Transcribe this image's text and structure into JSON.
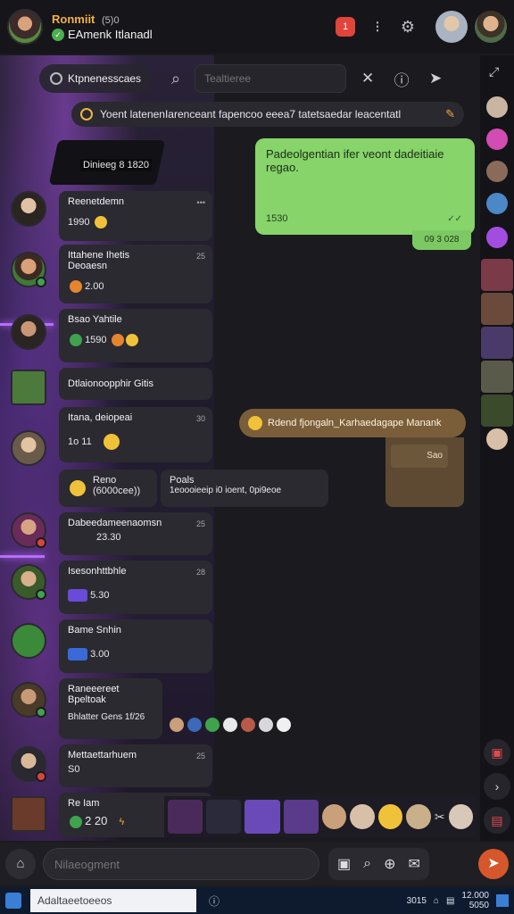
{
  "header": {
    "title": "Ronmiit",
    "title_suffix": "(5)0",
    "subtitle": "EAmenk Itlanadl",
    "notify_badge": "1"
  },
  "search": {
    "room_label": "Ktpnenesscaes",
    "placeholder": "Tealtieree"
  },
  "pinned": {
    "text": "Yoent latenenIarenceant fapencoo eeea7 tatetsaedar leacentatl"
  },
  "screen_label": "Dinieeg 8 1820",
  "messages_left": [
    {
      "name": "Reenetdemn",
      "meta": "•••",
      "time": "1990"
    },
    {
      "name": "Ittahene Ihetis",
      "line2": "Deoaesn",
      "meta": "25",
      "time": "2.00"
    },
    {
      "name": "Bsao Yahtile",
      "meta": "",
      "time": "1590"
    },
    {
      "name": "Dtlaionoopphir Gitis"
    },
    {
      "name": "Itana, deiopeai",
      "meta": "30",
      "time": "1o 11"
    },
    {
      "name": "Reno",
      "time": "(6000cee))"
    },
    {
      "name": "Poals",
      "body": "1eoooieeip i0 ioent, 0pi9eoe"
    },
    {
      "name": "Dabeedameenaomsn",
      "meta": "25",
      "time": "23.30"
    },
    {
      "name": "Isesonhttbhle",
      "meta": "28",
      "time": "5.30"
    },
    {
      "name": "Bame Snhin",
      "meta": "",
      "time": "3.00"
    },
    {
      "name": "Raneeereet",
      "line2": "Bpeltoak",
      "line3": "Bhlatter Gens 1f/26"
    },
    {
      "name": "Mettaettarhuem",
      "meta": "25",
      "time": "S0"
    },
    {
      "name": "Re Iam",
      "time": "2 20"
    }
  ],
  "messages_right": {
    "green_text": "Padeolgentian ifer veont dadeitiaie regao.",
    "green_time": "1530",
    "green_sub": "09 3 028",
    "brown_text": "Rdend fjongaln_Karhaedagape Manank",
    "brown_sub": "Sao"
  },
  "composer": {
    "placeholder": "Nilaeogment"
  },
  "taskbar": {
    "search_placeholder": "Adaltaeetoeeos",
    "tray_num": "3015",
    "clock_time": "12.000",
    "clock_date": "5050"
  },
  "colors": {
    "accent": "#d6572c",
    "green_bubble": "#86d46a",
    "brown_bubble": "#7a5e3a",
    "panel": "#2b2a30"
  }
}
